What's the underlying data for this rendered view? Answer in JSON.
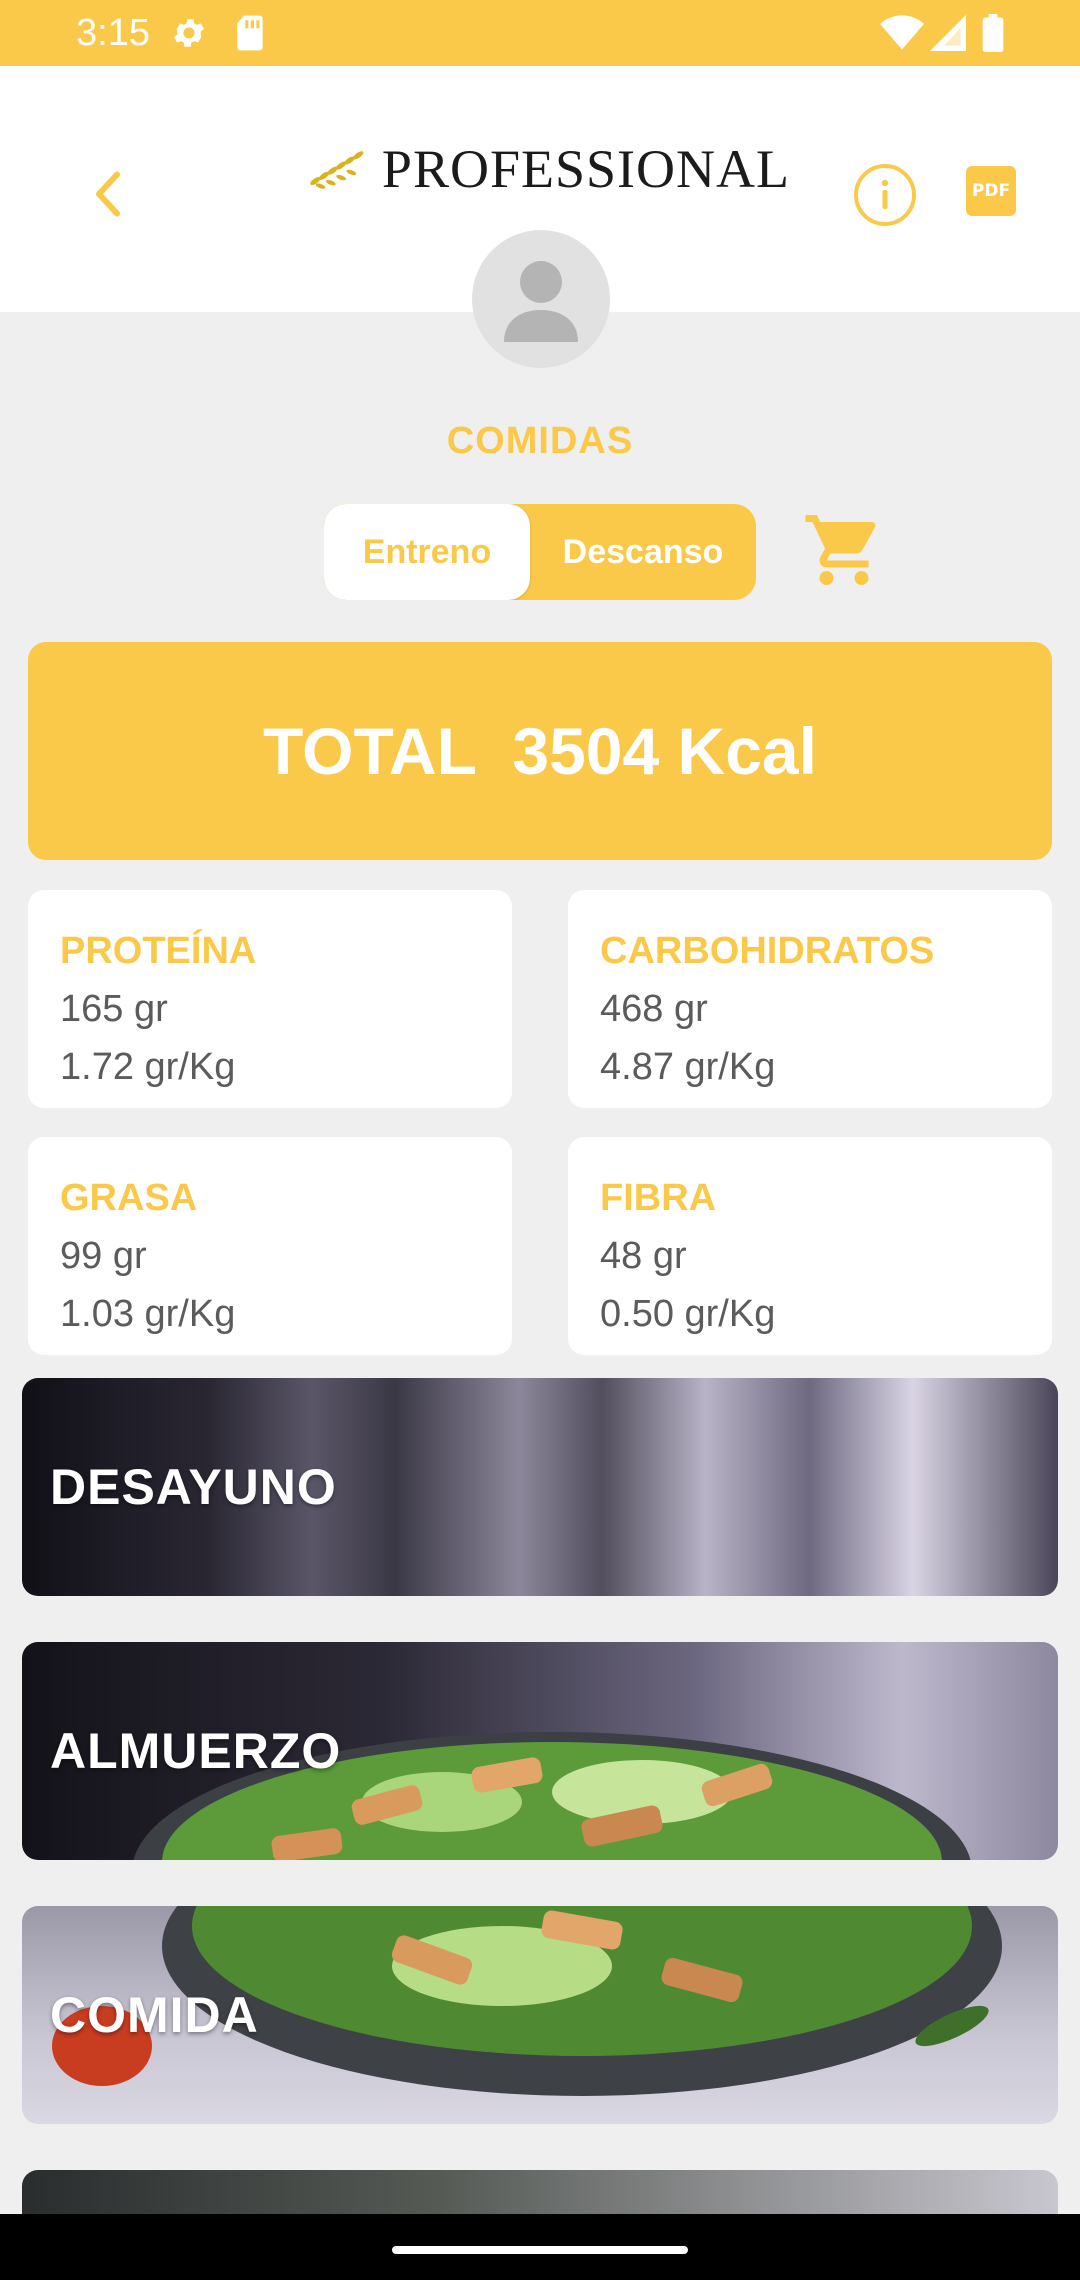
{
  "status_bar": {
    "time": "3:15"
  },
  "header": {
    "logo_text": "PROFESSIONAL",
    "pdf_label": "PDF"
  },
  "section_title": "COMIDAS",
  "toggle": {
    "option_1": "Entreno",
    "option_2": "Descanso",
    "selected": "Entreno"
  },
  "total": {
    "text": "TOTAL  3504 Kcal"
  },
  "macros": [
    {
      "title": "PROTEÍNA",
      "grams": "165 gr",
      "per_kg": "1.72 gr/Kg"
    },
    {
      "title": "CARBOHIDRATOS",
      "grams": "468 gr",
      "per_kg": "4.87 gr/Kg"
    },
    {
      "title": "GRASA",
      "grams": "99 gr",
      "per_kg": "1.03 gr/Kg"
    },
    {
      "title": "FIBRA",
      "grams": "48 gr",
      "per_kg": "0.50 gr/Kg"
    }
  ],
  "meals": [
    {
      "label": "DESAYUNO"
    },
    {
      "label": "ALMUERZO"
    },
    {
      "label": "COMIDA"
    }
  ],
  "colors": {
    "accent": "#fbc94a",
    "background": "#efefef",
    "text_gray": "#5b5b5b"
  },
  "icons": [
    "settings-icon",
    "sd-card-icon",
    "wifi-icon",
    "signal-icon",
    "battery-icon",
    "back-chevron-icon",
    "laurel-icon",
    "info-icon",
    "pdf-icon",
    "avatar-icon",
    "cart-icon"
  ]
}
